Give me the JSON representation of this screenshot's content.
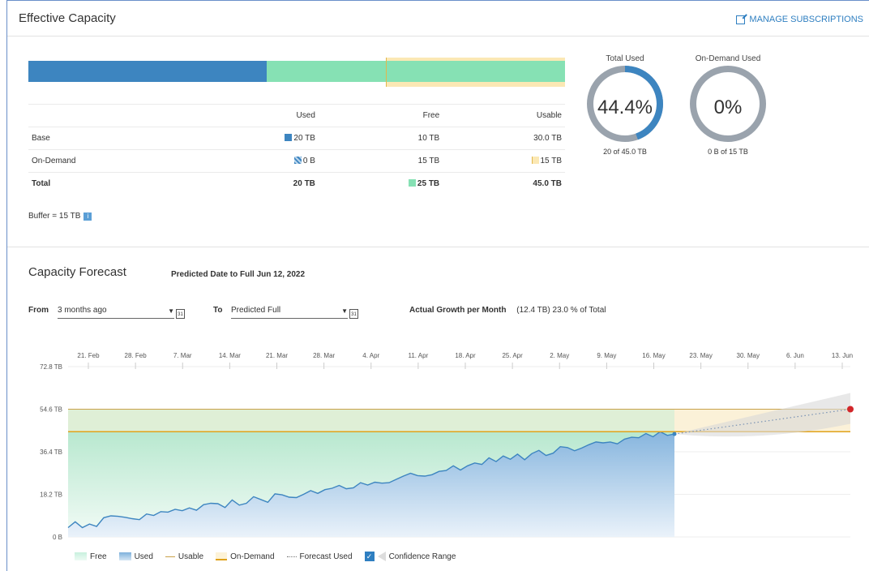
{
  "header": {
    "title": "Effective Capacity",
    "manage_label": "MANAGE SUBSCRIPTIONS"
  },
  "capacity_bar": {
    "used_fraction": 0.444,
    "usable_fraction": 1.0,
    "ondemand_start_fraction": 0.667
  },
  "table": {
    "columns": [
      "Used",
      "Free",
      "Usable"
    ],
    "rows": [
      {
        "label": "Base",
        "used": "20 TB",
        "free": "10 TB",
        "usable": "30.0 TB"
      },
      {
        "label": "On-Demand",
        "used": "0 B",
        "free": "15 TB",
        "usable": "15 TB"
      },
      {
        "label": "Total",
        "used": "20 TB",
        "free": "25 TB",
        "usable": "45.0 TB"
      }
    ],
    "buffer": "Buffer = 15 TB"
  },
  "donuts": {
    "total_used": {
      "label": "Total Used",
      "value": "44.4%",
      "sub": "20 of 45.0 TB",
      "fraction": 0.444
    },
    "ondemand_used": {
      "label": "On-Demand Used",
      "value": "0%",
      "sub": "0 B of 15 TB",
      "fraction": 0
    }
  },
  "forecast": {
    "title": "Capacity Forecast",
    "predicted": "Predicted Date to Full Jun 12, 2022",
    "from_label": "From",
    "from_value": "3 months ago",
    "to_label": "To",
    "to_value": "Predicted Full",
    "growth_label": "Actual Growth per Month",
    "growth_value": "(12.4 TB) 23.0 % of Total"
  },
  "chart_data": {
    "type": "area",
    "x_ticks": [
      "21. Feb",
      "28. Feb",
      "7. Mar",
      "14. Mar",
      "21. Mar",
      "28. Mar",
      "4. Apr",
      "11. Apr",
      "18. Apr",
      "25. Apr",
      "2. May",
      "9. May",
      "16. May",
      "23. May",
      "30. May",
      "6. Jun",
      "13. Jun"
    ],
    "y_ticks": [
      "72.8 TB",
      "54.6 TB",
      "36.4 TB",
      "18.2 TB",
      "0 B"
    ],
    "ylim": [
      0,
      72.8
    ],
    "usable_tb": 54.6,
    "ondemand_threshold_tb": 45.0,
    "used_series": [
      4.0,
      6.5,
      4.0,
      5.5,
      4.5,
      8.2,
      9.0,
      8.8,
      8.4,
      7.8,
      7.4,
      9.8,
      9.2,
      10.8,
      10.6,
      11.8,
      11.2,
      12.4,
      11.4,
      13.8,
      14.4,
      14.2,
      12.6,
      15.8,
      13.6,
      14.4,
      17.2,
      16.0,
      14.8,
      18.4,
      18.0,
      17.0,
      16.8,
      18.2,
      19.8,
      18.6,
      20.2,
      20.8,
      22.0,
      20.6,
      21.0,
      23.2,
      22.2,
      23.4,
      23.0,
      23.2,
      24.6,
      26.0,
      27.2,
      26.2,
      26.0,
      26.6,
      28.0,
      28.4,
      30.4,
      28.6,
      30.4,
      31.6,
      31.0,
      33.8,
      32.2,
      34.6,
      33.2,
      35.4,
      33.0,
      35.6,
      37.0,
      34.8,
      35.8,
      38.6,
      38.2,
      36.8,
      38.0,
      39.4,
      40.6,
      40.2,
      40.6,
      39.8,
      41.8,
      42.6,
      42.4,
      44.2,
      42.8,
      45.0,
      43.4,
      44.0
    ],
    "forecast_end_tb": 54.6,
    "legend": [
      "Free",
      "Used",
      "Usable",
      "On-Demand",
      "Forecast Used",
      "Confidence Range"
    ]
  }
}
